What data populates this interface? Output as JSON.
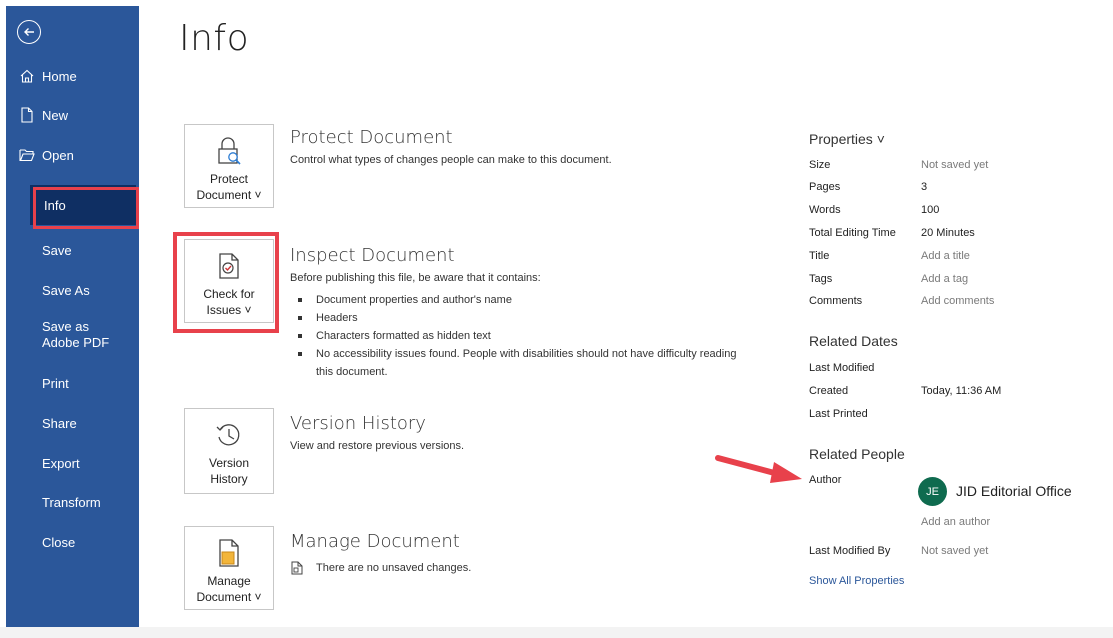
{
  "sidebar": {
    "back_label": "",
    "items": [
      {
        "label": "Home",
        "icon": "home-icon"
      },
      {
        "label": "New",
        "icon": "new-document-icon"
      },
      {
        "label": "Open",
        "icon": "open-folder-icon"
      },
      {
        "label": "Info"
      },
      {
        "label": "Save"
      },
      {
        "label": "Save As"
      },
      {
        "label": "Save as Adobe PDF"
      },
      {
        "label": "Print"
      },
      {
        "label": "Share"
      },
      {
        "label": "Export"
      },
      {
        "label": "Transform"
      },
      {
        "label": "Close"
      }
    ]
  },
  "page": {
    "title": "Info"
  },
  "sections": [
    {
      "tile_line1": "Protect",
      "tile_line2": "Document ˅",
      "icon": "lock-icon",
      "title": "Protect Document",
      "description": "Control what types of changes people can make to this document."
    },
    {
      "tile_line1": "Check for",
      "tile_line2": "Issues ˅",
      "icon": "inspect-document-icon",
      "title": "Inspect Document",
      "description": "Before publishing this file, be aware that it contains:",
      "bullets": [
        "Document properties and author's name",
        "Headers",
        "Characters formatted as hidden text",
        "No accessibility issues found. People with disabilities should not have difficulty reading this document."
      ]
    },
    {
      "tile_line1": "Version",
      "tile_line2": "History",
      "icon": "history-clock-icon",
      "title": "Version History",
      "description": "View and restore previous versions."
    },
    {
      "tile_line1": "Manage",
      "tile_line2": "Document ˅",
      "icon": "manage-document-icon",
      "title": "Manage Document",
      "description": "There are no unsaved changes."
    }
  ],
  "properties": {
    "header": "Properties ˅",
    "rows": [
      {
        "label": "Size",
        "value": "Not saved yet"
      },
      {
        "label": "Pages",
        "value": "3"
      },
      {
        "label": "Words",
        "value": "100"
      },
      {
        "label": "Total Editing Time",
        "value": "20 Minutes"
      },
      {
        "label": "Title",
        "value": "Add a title"
      },
      {
        "label": "Tags",
        "value": "Add a tag"
      },
      {
        "label": "Comments",
        "value": "Add comments"
      }
    ]
  },
  "related_dates": {
    "header": "Related Dates",
    "rows": [
      {
        "label": "Last Modified",
        "value": ""
      },
      {
        "label": "Created",
        "value": "Today, 11:36 AM"
      },
      {
        "label": "Last Printed",
        "value": ""
      }
    ]
  },
  "related_people": {
    "header": "Related People",
    "author_label": "Author",
    "author_initials": "JE",
    "author_name": "JID Editorial Office",
    "add_author": "Add an author",
    "last_modified_by_label": "Last Modified By",
    "last_modified_by_value": "Not saved yet",
    "show_all": "Show All Properties"
  },
  "colors": {
    "sidebar": "#2b579a",
    "sidebar_selected": "#0f2f63",
    "highlight": "#e8414b",
    "avatar": "#0f6b4f",
    "link": "#2b579a"
  }
}
